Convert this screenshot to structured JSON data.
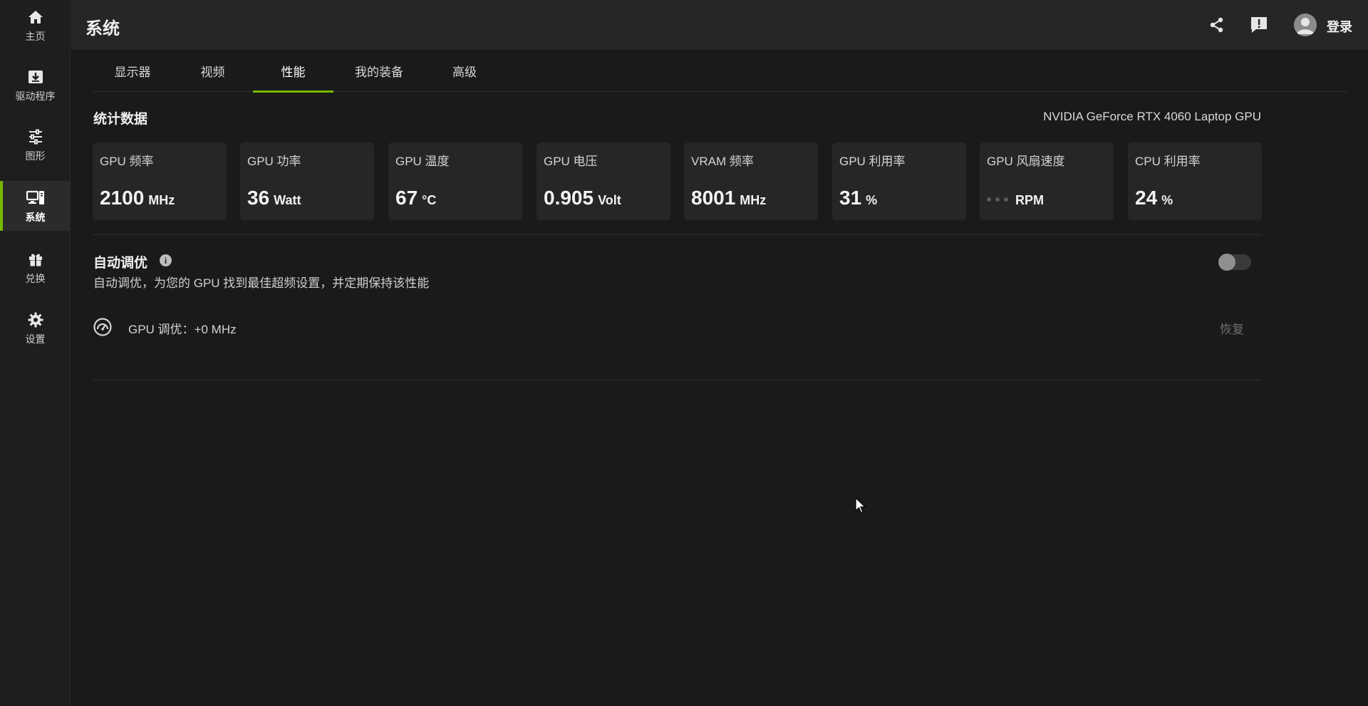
{
  "sidebar": {
    "items": [
      {
        "label": "主页",
        "icon": "home-icon"
      },
      {
        "label": "驱动程序",
        "icon": "driver-download-icon"
      },
      {
        "label": "图形",
        "icon": "sliders-icon"
      },
      {
        "label": "系统",
        "icon": "system-icon",
        "active": true
      },
      {
        "label": "兑换",
        "icon": "gift-icon"
      },
      {
        "label": "设置",
        "icon": "gear-icon"
      }
    ]
  },
  "header": {
    "title": "系统",
    "login_label": "登录",
    "icons": [
      "share-icon",
      "feedback-icon",
      "user-avatar"
    ]
  },
  "tabs": [
    {
      "label": "显示器"
    },
    {
      "label": "视频"
    },
    {
      "label": "性能",
      "active": true
    },
    {
      "label": "我的装备"
    },
    {
      "label": "高级"
    }
  ],
  "stats": {
    "title": "统计数据",
    "gpu_name": "NVIDIA GeForce RTX 4060 Laptop GPU",
    "cards": [
      {
        "label": "GPU 频率",
        "value": "2100",
        "unit": "MHz"
      },
      {
        "label": "GPU 功率",
        "value": "36",
        "unit": "Watt"
      },
      {
        "label": "GPU 温度",
        "value": "67",
        "unit": "°C"
      },
      {
        "label": "GPU 电压",
        "value": "0.905",
        "unit": "Volt"
      },
      {
        "label": "VRAM 频率",
        "value": "8001",
        "unit": "MHz"
      },
      {
        "label": "GPU 利用率",
        "value": "31",
        "unit": "%"
      },
      {
        "label": "GPU 风扇速度",
        "value": "",
        "unit": "RPM"
      },
      {
        "label": "CPU 利用率",
        "value": "24",
        "unit": "%"
      }
    ]
  },
  "auto_tune": {
    "title": "自动调优",
    "description": "自动调优，为您的 GPU 找到最佳超频设置，并定期保持该性能",
    "enabled": false,
    "gpu_tune_label": "GPU 调优：",
    "gpu_tune_value": "+0 MHz",
    "restore_label": "恢复"
  },
  "colors": {
    "accent": "#76b900",
    "background": "#1a1a1a",
    "card": "#262626"
  }
}
